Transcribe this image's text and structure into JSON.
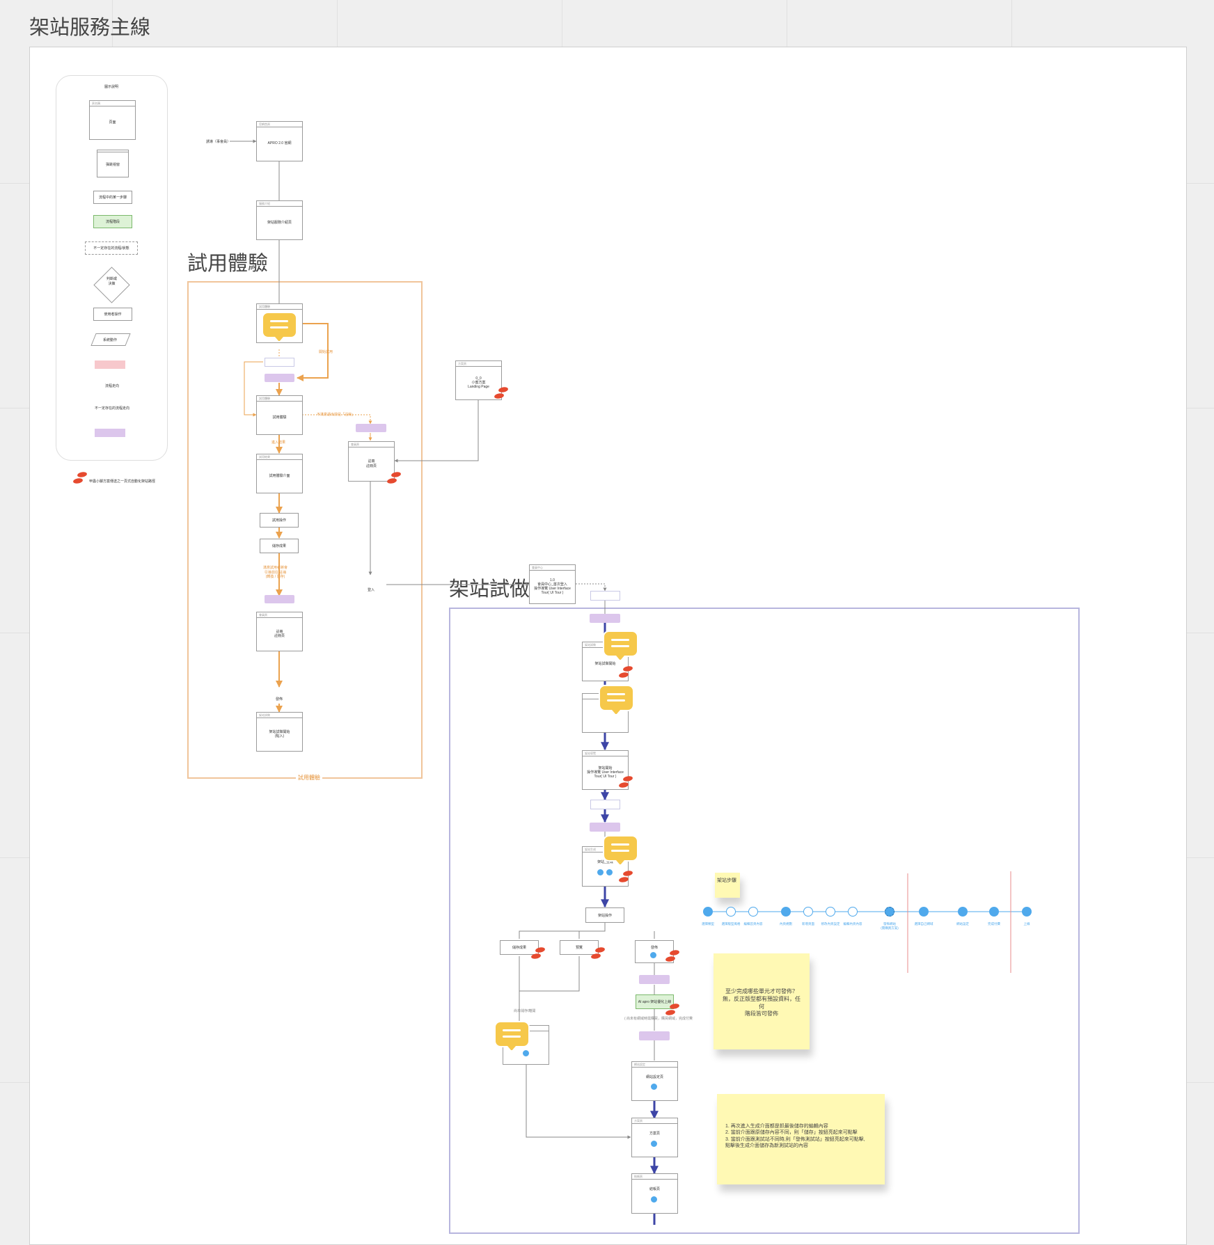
{
  "board": {
    "title": "架站服務主線"
  },
  "legend": {
    "title": "圖示說明",
    "page_header": "頁名稱",
    "page_label": "頁面",
    "modal_label": "彈跳視窗",
    "process_label": "流程中的某一步驟",
    "process_green_label": "流程階段",
    "optional_label": "不一定存在的流程/狀態",
    "decision_label": "判斷或\n決策",
    "action_label": "使用者操作",
    "data_label": "系統動作",
    "flow_label": "流程走向",
    "optional_flow_label": "不一定存在的流程走向",
    "feet_note": "甲蟲小腳方案傳送之一頁式自動化架站路徑"
  },
  "sections": {
    "trial": {
      "title": "試用體驗",
      "bottom_label": "試用體驗"
    },
    "build": {
      "title": "架站試做"
    }
  },
  "nodes": {
    "ad_source": "誘導（事會員）",
    "apro": "APRO 2.0 官網",
    "apro_header": "官網首頁",
    "intro": "架站服務介紹頁",
    "intro_header": "服務介紹",
    "trial_page": "試用體驗",
    "trial_page_header": "試用體驗",
    "trial_result": "試用體驗介面",
    "trial_result_header": "試用結果",
    "trial_action": "試用操作",
    "trial_save": "儲存成果",
    "register": "註冊\n註冊頁",
    "register_header": "會員頁",
    "register2": "註冊\n註冊頁",
    "register2_header": "會員頁",
    "done_label": "發佈",
    "enter_trial": "架站試做開始\n(點入)",
    "enter_trial_header": "架站試做",
    "landing": "0_0\n小蜜方案\nLanding Page",
    "landing_header": "方案頁",
    "join_label": "登入",
    "guide": "1.0\n會員中心_首次登入\n操作導覽 User Interface\nTour( UI Tour )",
    "guide_header": "會員中心",
    "build_intro": "架站試做開始",
    "build_intro_header": "架站試做",
    "ui_tour": "架站開始\n操作導覽 User Interface\nTour( UI Tour )",
    "ui_tour_header": "架站導覽",
    "generate": "架站_生成",
    "generate_header": "架站生成",
    "build_action": "架站操作",
    "save_result": "儲存成果",
    "preview": "預覽",
    "publish": "發佈",
    "publish_header": "發佈",
    "ai_generate": "AI apro 架站優化上線",
    "site_settings": "網站設定頁",
    "site_settings_header": "網站設定",
    "plan_page": "方案頁",
    "plan_page_header": "方案頁",
    "checkout": "結帳頁",
    "checkout_header": "結帳頁"
  },
  "edge_labels": {
    "trial_a": "開始試用",
    "trial_to_register": "不滿意退出前往「註冊」",
    "trial_down": "進入結果",
    "trial_decision": "滿意試用者將會\n引導前往 註冊\n(轉換 / 留存)",
    "not_saved": "尚未儲存/離開",
    "publish_note": "( 尚未有網域時需購買，購買網域，完成付費"
  },
  "steps": {
    "title": "架站步驟",
    "items": [
      "選擇類型",
      "選擇版型風格",
      "編輯首頁內容",
      "內頁規劃",
      "新增頁面",
      "修改內頁設定",
      "編輯內頁內容",
      "發佈網站\n(需購買方案)",
      "選擇自己網域",
      "網站設定",
      "完成付費",
      "上線"
    ],
    "states": [
      "filled",
      "open",
      "open",
      "filled",
      "open",
      "open",
      "open",
      "dashed",
      "filled",
      "filled",
      "filled",
      "filled"
    ]
  },
  "stickies": {
    "a": "至少完成哪些單元才可發佈？\n無，反正版型都有預設資料，任何\n階段皆可發佈",
    "b": "1. 再次進入生成介面都是抓最後儲存的編輯內容\n2. 當前介面跟原儲存內容不同，則「儲存」按鈕亮起來可點擊\n3. 當前介面跟測試站不同時,則「發佈測試站」按鈕亮起來可點擊,\n點擊後生成介面儲存為新測試站的內容"
  },
  "colors": {
    "orange": "#eba24e",
    "navy": "#3d45a6",
    "frame_blue": "#b7b5de",
    "pill_purple": "#dcc6ec",
    "comment_yellow": "#f6c84a",
    "feet_red": "#e64a2f",
    "step_blue": "#4fa9ec",
    "red_line": "#e88b8b"
  },
  "icons": [
    "comment-icon",
    "footprint-icon",
    "progress-dot-icon"
  ]
}
